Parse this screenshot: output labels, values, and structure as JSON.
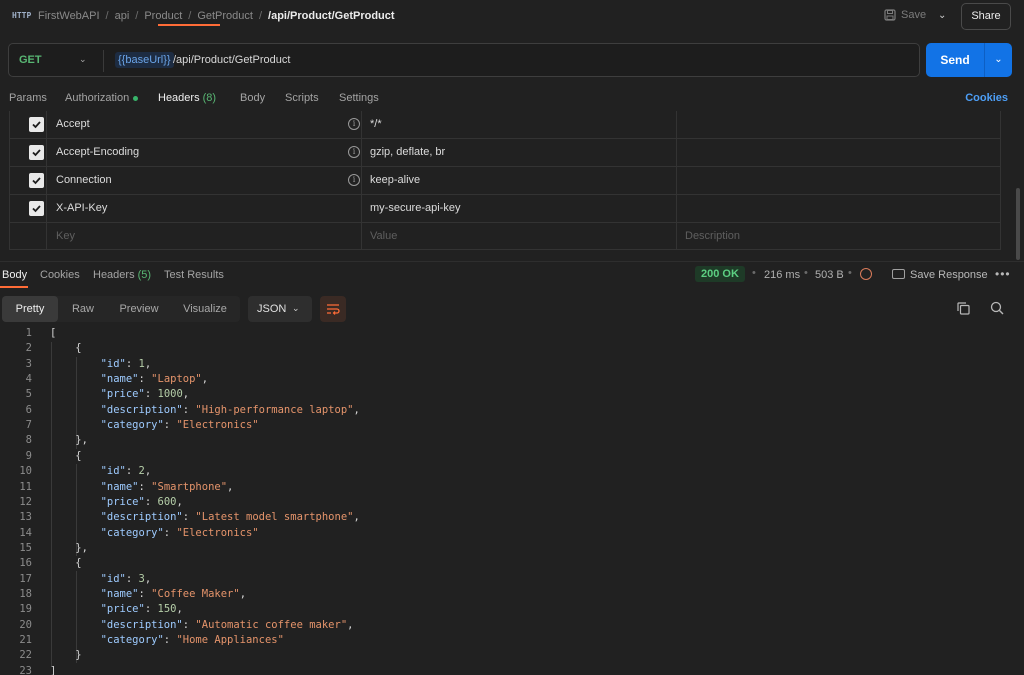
{
  "topbar": {
    "app_icon": "http-icon",
    "app_icon_text": "HTTP",
    "breadcrumb": [
      "FirstWebAPI",
      "api",
      "Product",
      "GetProduct"
    ],
    "breadcrumb_current": "/api/Product/GetProduct",
    "save_label": "Save",
    "share_label": "Share"
  },
  "request": {
    "method": "GET",
    "url_variable": "{{baseUrl}}",
    "url_path": "/api/Product/GetProduct",
    "send_label": "Send"
  },
  "request_tabs": {
    "params": "Params",
    "authorization": "Authorization",
    "headers": "Headers",
    "headers_count": "(8)",
    "body": "Body",
    "scripts": "Scripts",
    "settings": "Settings",
    "cookies": "Cookies"
  },
  "headers_table": {
    "rows": [
      {
        "key": "Accept",
        "value": "*/*",
        "info": true,
        "checked": true
      },
      {
        "key": "Accept-Encoding",
        "value": "gzip, deflate, br",
        "info": true,
        "checked": true
      },
      {
        "key": "Connection",
        "value": "keep-alive",
        "info": true,
        "checked": true
      },
      {
        "key": "X-API-Key",
        "value": "my-secure-api-key",
        "info": false,
        "checked": true
      }
    ],
    "placeholder_key": "Key",
    "placeholder_value": "Value",
    "placeholder_description": "Description"
  },
  "response": {
    "tabs": {
      "body": "Body",
      "cookies": "Cookies",
      "headers": "Headers",
      "headers_count": "(5)",
      "test_results": "Test Results"
    },
    "status": "200 OK",
    "time": "216 ms",
    "size": "503 B",
    "save_response": "Save Response",
    "views": [
      "Pretty",
      "Raw",
      "Preview",
      "Visualize"
    ],
    "format": "JSON",
    "body_lines": [
      "[",
      "    {",
      "        \"id\": 1,",
      "        \"name\": \"Laptop\",",
      "        \"price\": 1000,",
      "        \"description\": \"High-performance laptop\",",
      "        \"category\": \"Electronics\"",
      "    },",
      "    {",
      "        \"id\": 2,",
      "        \"name\": \"Smartphone\",",
      "        \"price\": 600,",
      "        \"description\": \"Latest model smartphone\",",
      "        \"category\": \"Electronics\"",
      "    },",
      "    {",
      "        \"id\": 3,",
      "        \"name\": \"Coffee Maker\",",
      "        \"price\": 150,",
      "        \"description\": \"Automatic coffee maker\",",
      "        \"category\": \"Home Appliances\"",
      "    }",
      "]"
    ]
  },
  "colors": {
    "accent": "#ff6c37",
    "send": "#1273e6",
    "status_ok": "#5ccf82",
    "method_get": "#58b673"
  }
}
